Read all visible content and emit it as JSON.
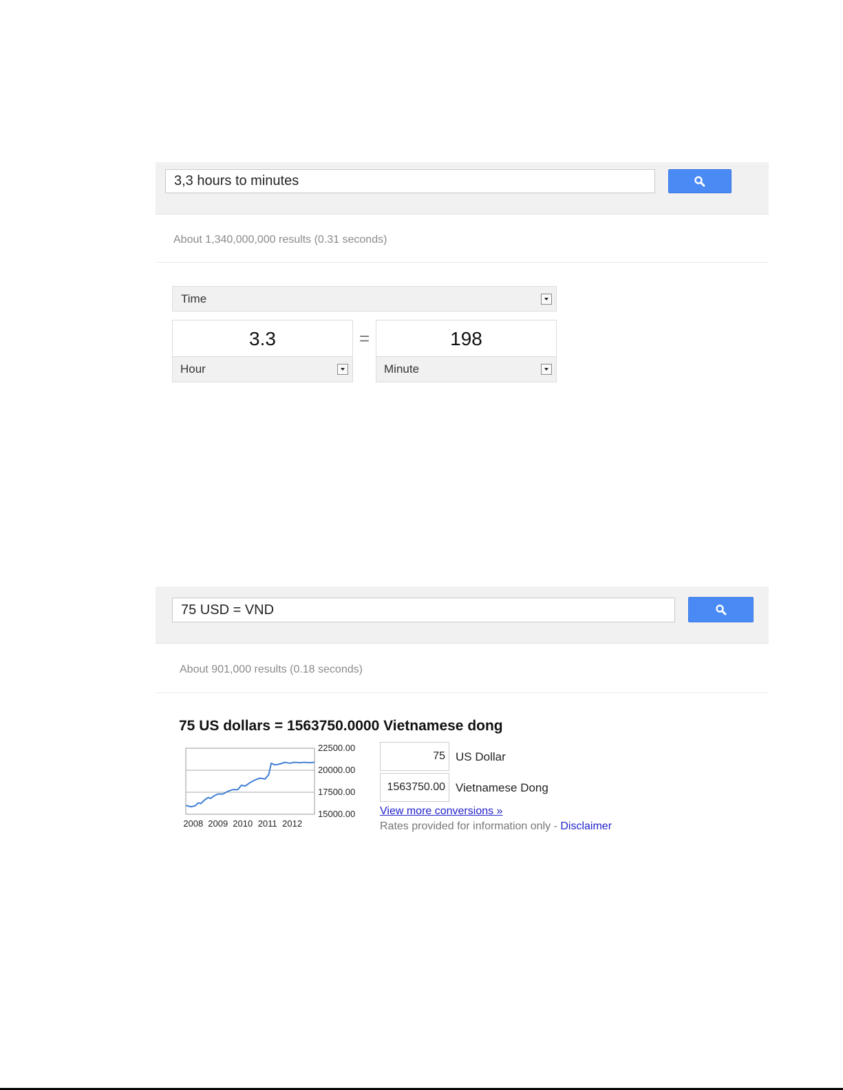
{
  "search1": {
    "query": "3,3 hours to minutes",
    "button_icon": "search-icon",
    "result_stats": "About 1,340,000,000 results (0.31 seconds)"
  },
  "converter": {
    "category": "Time",
    "from_value": "3.3",
    "from_unit": "Hour",
    "equals": "=",
    "to_value": "198",
    "to_unit": "Minute"
  },
  "search2": {
    "query": "75 USD = VND",
    "button_icon": "search-icon",
    "result_stats": "About 901,000 results (0.18 seconds)"
  },
  "currency": {
    "title": "75 US dollars = 1563750.0000 Vietnamese dong",
    "amount_from": "75",
    "currency_from": "US Dollar",
    "amount_to": "1563750.00",
    "currency_to": "Vietnamese Dong",
    "more_link": "View more conversions »",
    "disclaimer_text": "Rates provided for information only - ",
    "disclaimer_link": "Disclaimer"
  },
  "chart_data": {
    "type": "line",
    "x_tick_labels": [
      "2008",
      "2009",
      "2010",
      "2011",
      "2012"
    ],
    "y_tick_labels": [
      "22500.00",
      "20000.00",
      "17500.00",
      "15000.00"
    ],
    "ylim": [
      15000,
      22500
    ],
    "xlim": [
      2007.7,
      2012.9
    ],
    "grid": true,
    "series_color": "#3f7fd6",
    "series": [
      {
        "x": [
          2007.7,
          2007.9,
          2008.0,
          2008.1,
          2008.2,
          2008.3,
          2008.45,
          2008.6,
          2008.7,
          2008.85,
          2009.0,
          2009.2,
          2009.4,
          2009.6,
          2009.8,
          2009.95,
          2010.1,
          2010.3,
          2010.5,
          2010.7,
          2010.9,
          2011.05,
          2011.15,
          2011.3,
          2011.5,
          2011.7,
          2011.9,
          2012.1,
          2012.3,
          2012.5,
          2012.7,
          2012.9
        ],
        "y": [
          16000,
          15850,
          15900,
          16000,
          16300,
          16200,
          16600,
          16900,
          16800,
          17100,
          17300,
          17300,
          17600,
          17800,
          17800,
          18300,
          18200,
          18600,
          18900,
          19100,
          19000,
          19500,
          20800,
          20600,
          20700,
          20900,
          20800,
          20900,
          20850,
          20900,
          20850,
          20900
        ]
      }
    ]
  }
}
